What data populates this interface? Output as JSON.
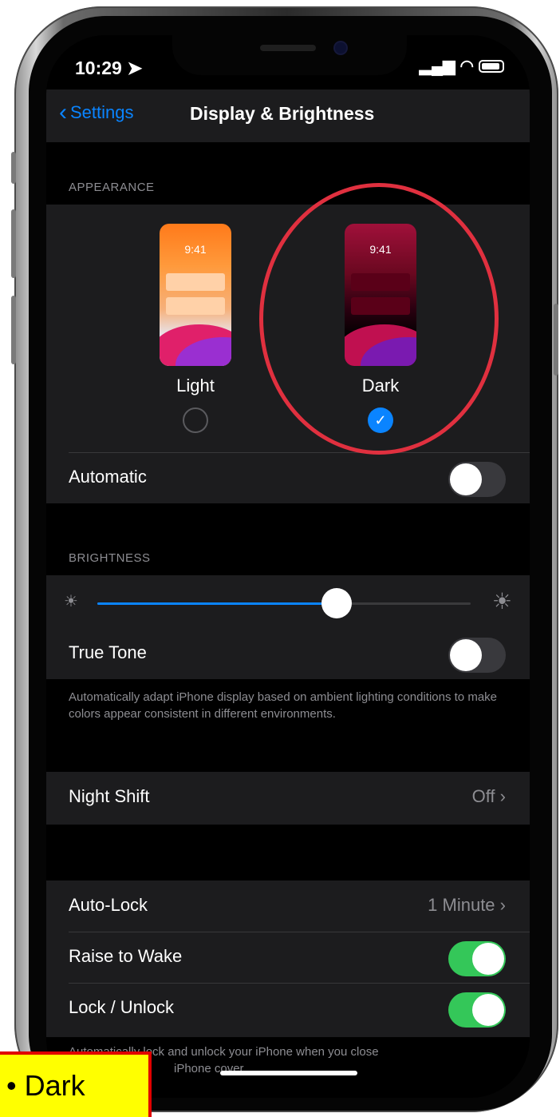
{
  "status": {
    "time": "10:29",
    "location_icon": "location-arrow-icon",
    "signal_icon": "cellular-signal-icon",
    "wifi_icon": "wifi-icon",
    "battery_icon": "battery-icon"
  },
  "nav": {
    "back_label": "Settings",
    "title": "Display & Brightness"
  },
  "appearance": {
    "section_label": "APPEARANCE",
    "thumb_time": "9:41",
    "options": [
      {
        "label": "Light",
        "selected": false
      },
      {
        "label": "Dark",
        "selected": true
      }
    ],
    "automatic_label": "Automatic",
    "automatic_on": false
  },
  "brightness": {
    "section_label": "BRIGHTNESS",
    "level": 0.64,
    "true_tone_label": "True Tone",
    "true_tone_on": false,
    "true_tone_footnote": "Automatically adapt iPhone display based on ambient lighting conditions to make colors appear consistent in different environments."
  },
  "night_shift": {
    "label": "Night Shift",
    "value": "Off"
  },
  "lock": {
    "auto_lock_label": "Auto-Lock",
    "auto_lock_value": "1 Minute",
    "raise_to_wake_label": "Raise to Wake",
    "raise_to_wake_on": true,
    "lock_unlock_label": "Lock / Unlock",
    "lock_unlock_on": true,
    "footnote_line1": "Automatically lock and unlock your iPhone when you close",
    "footnote_line2": "iPhone cover."
  },
  "caption": {
    "text": "• Dark"
  },
  "colors": {
    "accent": "#0a84ff",
    "toggle_on": "#34c759",
    "highlight": "#e0303f",
    "caption_bg": "#ffff00"
  }
}
